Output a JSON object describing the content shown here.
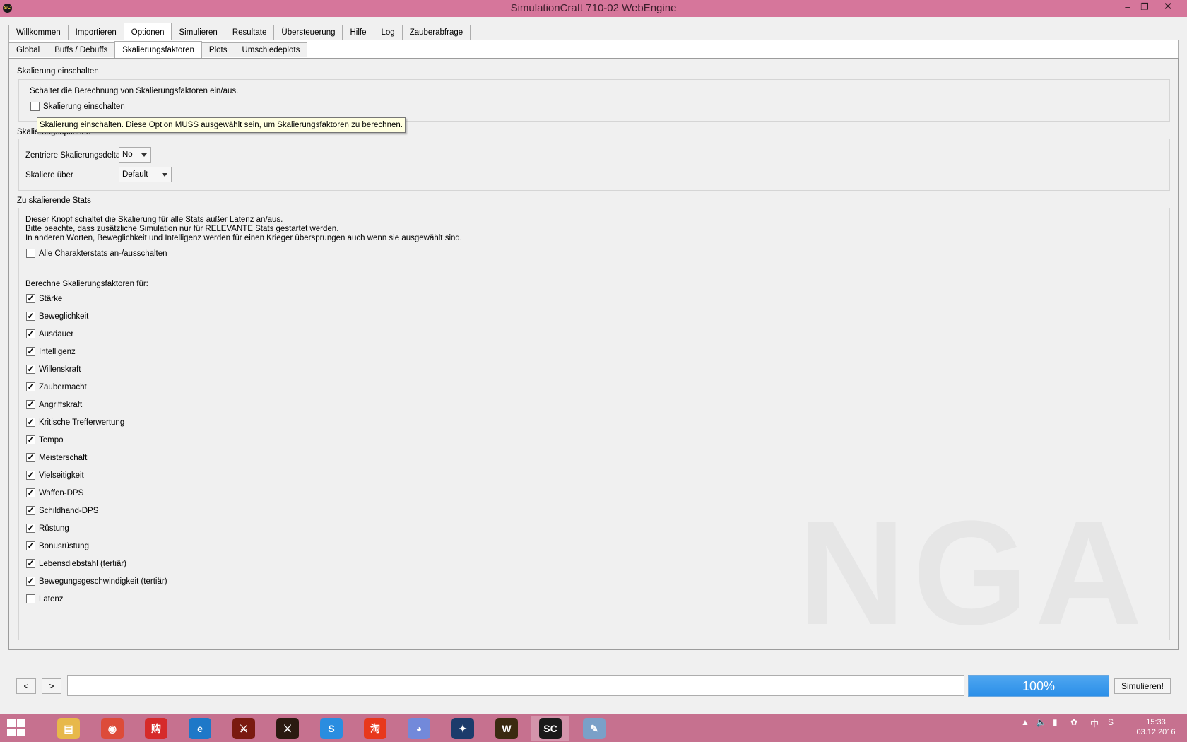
{
  "window": {
    "title": "SimulationCraft 710-02 WebEngine",
    "app_icon": "SC"
  },
  "main_tabs": [
    {
      "label": "Willkommen"
    },
    {
      "label": "Importieren"
    },
    {
      "label": "Optionen",
      "active": true
    },
    {
      "label": "Simulieren"
    },
    {
      "label": "Resultate"
    },
    {
      "label": "Übersteuerung"
    },
    {
      "label": "Hilfe"
    },
    {
      "label": "Log"
    },
    {
      "label": "Zauberabfrage"
    }
  ],
  "sub_tabs": [
    {
      "label": "Global"
    },
    {
      "label": "Buffs / Debuffs"
    },
    {
      "label": "Skalierungsfaktoren",
      "active": true
    },
    {
      "label": "Plots"
    },
    {
      "label": "Umschiedeplots"
    }
  ],
  "scaling_enable": {
    "title": "Skalierung einschalten",
    "description": "Schaltet die Berechnung von Skalierungsfaktoren ein/aus.",
    "checkbox_label": "Skalierung einschalten",
    "checked": false
  },
  "tooltip": "Skalierung einschalten. Diese Option MUSS ausgewählt sein, um Skalierungsfaktoren zu berechnen.",
  "scaling_options": {
    "title": "Skalierungsoptionen",
    "center_delta_label": "Zentriere Skalierungsdelta",
    "center_delta_value": "No",
    "scale_over_label": "Skaliere über",
    "scale_over_value": "Default"
  },
  "stats": {
    "title": "Zu skalierende Stats",
    "desc_line1": "Dieser Knopf schaltet die Skalierung für alle Stats außer Latenz an/aus.",
    "desc_line2": "Bitte beachte, dass zusätzliche Simulation nur für RELEVANTE Stats gestartet werden.",
    "desc_line3": "In anderen Worten, Beweglichkeit und Intelligenz werden für einen Krieger übersprungen auch wenn sie ausgewählt sind.",
    "toggle_all_label": "Alle Charakterstats an-/ausschalten",
    "compute_label": "Berechne Skalierungsfaktoren für:",
    "items": [
      {
        "label": "Stärke",
        "checked": true
      },
      {
        "label": "Beweglichkeit",
        "checked": true
      },
      {
        "label": "Ausdauer",
        "checked": true
      },
      {
        "label": "Intelligenz",
        "checked": true
      },
      {
        "label": "Willenskraft",
        "checked": true
      },
      {
        "label": "Zaubermacht",
        "checked": true
      },
      {
        "label": "Angriffskraft",
        "checked": true
      },
      {
        "label": "Kritische Trefferwertung",
        "checked": true
      },
      {
        "label": "Tempo",
        "checked": true
      },
      {
        "label": "Meisterschaft",
        "checked": true
      },
      {
        "label": "Vielseitigkeit",
        "checked": true
      },
      {
        "label": "Waffen-DPS",
        "checked": true
      },
      {
        "label": "Schildhand-DPS",
        "checked": true
      },
      {
        "label": "Rüstung",
        "checked": true
      },
      {
        "label": "Bonusrüstung",
        "checked": true
      },
      {
        "label": "Lebensdiebstahl (tertiär)",
        "checked": true
      },
      {
        "label": "Bewegungsgeschwindigkeit (tertiär)",
        "checked": true
      },
      {
        "label": "Latenz",
        "checked": false
      }
    ]
  },
  "watermark": "NGA",
  "bottom": {
    "back_label": "<",
    "forward_label": ">",
    "progress_percent": 100,
    "progress_text": "100%",
    "simulate_label": "Simulieren!"
  },
  "taskbar": {
    "ime": "中",
    "time": "15:33",
    "date": "03.12.2016",
    "apps": [
      "file-explorer-icon",
      "chrome-icon",
      "shopping-icon",
      "ie-icon",
      "game-icon",
      "game2-icon",
      "sogou-icon",
      "taobao-icon",
      "discord-icon",
      "battlenet-icon",
      "wow-icon",
      "simc-icon",
      "paint-icon"
    ]
  },
  "colors": {
    "titlebar": "#d6769b",
    "taskbar": "#c6718f",
    "progress": "#2b8fe8"
  }
}
